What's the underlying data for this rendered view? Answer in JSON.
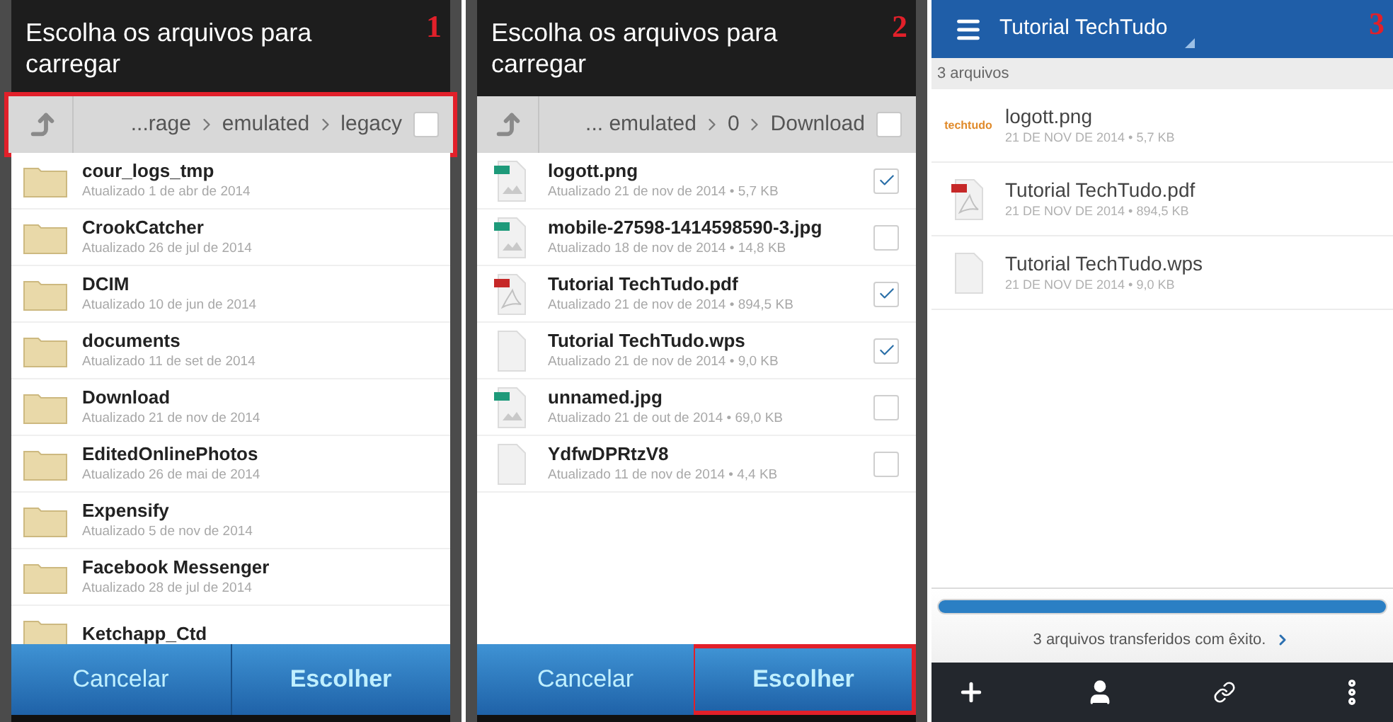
{
  "panels": [
    {
      "kind": "picker",
      "step_number": "1",
      "title": "Escolha os arquivos para carregar",
      "breadcrumb": {
        "highlighted": true,
        "parts": [
          "...rage",
          "emulated",
          "legacy"
        ],
        "select_all_checked": false
      },
      "items": [
        {
          "kind": "folder",
          "name": "cour_logs_tmp",
          "meta": "Atualizado 1 de abr de 2014"
        },
        {
          "kind": "folder",
          "name": "CrookCatcher",
          "meta": "Atualizado 26 de jul de 2014"
        },
        {
          "kind": "folder",
          "name": "DCIM",
          "meta": "Atualizado 10 de jun de 2014"
        },
        {
          "kind": "folder",
          "name": "documents",
          "meta": "Atualizado 11 de set de 2014"
        },
        {
          "kind": "folder",
          "name": "Download",
          "meta": "Atualizado 21 de nov de 2014"
        },
        {
          "kind": "folder",
          "name": "EditedOnlinePhotos",
          "meta": "Atualizado 26 de mai de 2014"
        },
        {
          "kind": "folder",
          "name": "Expensify",
          "meta": "Atualizado 5 de nov de 2014"
        },
        {
          "kind": "folder",
          "name": "Facebook Messenger",
          "meta": "Atualizado 28 de jul de 2014"
        },
        {
          "kind": "folder",
          "name": "Ketchapp_Ctd"
        }
      ],
      "buttons": [
        {
          "label": "Cancelar",
          "bold": false,
          "highlighted": false
        },
        {
          "label": "Escolher",
          "bold": true,
          "highlighted": false
        }
      ]
    },
    {
      "kind": "picker",
      "step_number": "2",
      "title": "Escolha os arquivos para carregar",
      "breadcrumb": {
        "highlighted": false,
        "parts": [
          "... emulated",
          "0",
          "Download"
        ],
        "select_all_checked": false
      },
      "items": [
        {
          "kind": "image",
          "name": "logott.png",
          "meta": "Atualizado 21 de nov de 2014 • 5,7 KB",
          "checked": true
        },
        {
          "kind": "image",
          "name": "mobile-27598-1414598590-3.jpg",
          "meta": "Atualizado 18 de nov de 2014 • 14,8 KB",
          "checked": false
        },
        {
          "kind": "pdf",
          "name": "Tutorial TechTudo.pdf",
          "meta": "Atualizado 21 de nov de 2014 • 894,5 KB",
          "checked": true
        },
        {
          "kind": "file",
          "name": "Tutorial TechTudo.wps",
          "meta": "Atualizado 21 de nov de 2014 • 9,0 KB",
          "checked": true
        },
        {
          "kind": "image",
          "name": "unnamed.jpg",
          "meta": "Atualizado 21 de out de 2014 • 69,0 KB",
          "checked": false
        },
        {
          "kind": "file",
          "name": "YdfwDPRtzV8",
          "meta": "Atualizado 11 de nov de 2014 • 4,4 KB",
          "checked": false
        }
      ],
      "buttons": [
        {
          "label": "Cancelar",
          "bold": false,
          "highlighted": false
        },
        {
          "label": "Escolher",
          "bold": true,
          "highlighted": true
        }
      ]
    },
    {
      "kind": "folder_view",
      "step_number": "3",
      "title": "Tutorial TechTudo",
      "count": "3 arquivos",
      "files": [
        {
          "kind": "logo",
          "thumbnail_text": "techtudo",
          "name": "logott.png",
          "meta": "21 DE NOV DE 2014 • 5,7 KB"
        },
        {
          "kind": "pdf",
          "name": "Tutorial TechTudo.pdf",
          "meta": "21 DE NOV DE 2014 • 894,5 KB"
        },
        {
          "kind": "file",
          "name": "Tutorial TechTudo.wps",
          "meta": "21 DE NOV DE 2014 • 9,0 KB"
        }
      ],
      "progress": {
        "level": 1
      },
      "status": "3 arquivos transferidos com êxito."
    }
  ]
}
